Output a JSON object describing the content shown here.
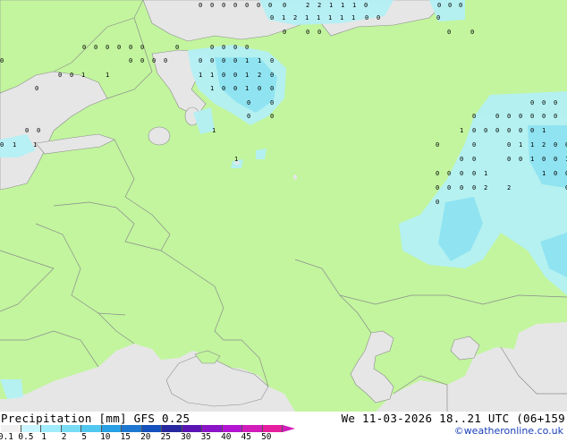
{
  "footer": {
    "product_title": "Precipitation [mm] GFS 0.25",
    "valid_time": "We 11-03-2026 18..21 UTC (06+159",
    "credit": "©weatheronline.co.uk"
  },
  "legend": {
    "ticks": [
      "0.1",
      "0.5",
      "1",
      "2",
      "5",
      "10",
      "15",
      "20",
      "25",
      "30",
      "35",
      "40",
      "45",
      "50"
    ],
    "colors": [
      "#f0f0f0",
      "#c8f5ff",
      "#a0ecff",
      "#78dcf5",
      "#50c8f0",
      "#28a0e6",
      "#1e78d2",
      "#1450be",
      "#2828a0",
      "#5a14b4",
      "#8c14c8",
      "#b414d2",
      "#d21dba",
      "#e61ea0"
    ]
  },
  "colors": {
    "land": "#c2f59e",
    "sea": "#e6e6e6",
    "precip_light": "#b4f0f5",
    "precip_mid": "#8ce2f2",
    "border": "#8c8c8c"
  },
  "map_labels": [
    "0",
    "0",
    "0",
    "0",
    "0",
    "0",
    "0",
    "0",
    "2",
    "2",
    "1",
    "1",
    "1",
    "0",
    "0",
    "0",
    "0",
    "0",
    "1",
    "2",
    "1",
    "1",
    "1",
    "1",
    "1",
    "0",
    "0",
    "0",
    "0",
    "0",
    "0",
    "0",
    "0",
    "0",
    "0",
    "0",
    "0",
    "0",
    "0",
    "0",
    "0",
    "0",
    "0",
    "0",
    "0",
    "0",
    "0",
    "0",
    "0",
    "0",
    "0",
    "0",
    "0",
    "1",
    "1",
    "0",
    "0",
    "0",
    "1",
    "1",
    "1",
    "1",
    "0",
    "0",
    "1",
    "2",
    "0",
    "1",
    "0",
    "0",
    "1",
    "0",
    "0",
    "0",
    "0",
    "0",
    "0",
    "0",
    "0",
    "0",
    "0",
    "0",
    "0",
    "0",
    "0",
    "0",
    "0",
    "0",
    "1",
    "0",
    "0",
    "0",
    "0",
    "0",
    "0",
    "1",
    "1",
    "0",
    "0",
    "0",
    "0",
    "0",
    "1",
    "1",
    "2",
    "0",
    "0",
    "0",
    "1",
    "1",
    "0",
    "0",
    "0",
    "0",
    "1",
    "0",
    "0",
    "1",
    "1",
    "0",
    "0",
    "0",
    "0",
    "1",
    "1",
    "0",
    "0",
    "0",
    "0",
    "0",
    "0",
    "2",
    "2",
    "0",
    "0",
    "0",
    "0",
    "0",
    "0",
    "0",
    "0",
    "0",
    "0",
    "1",
    "0",
    "0"
  ]
}
